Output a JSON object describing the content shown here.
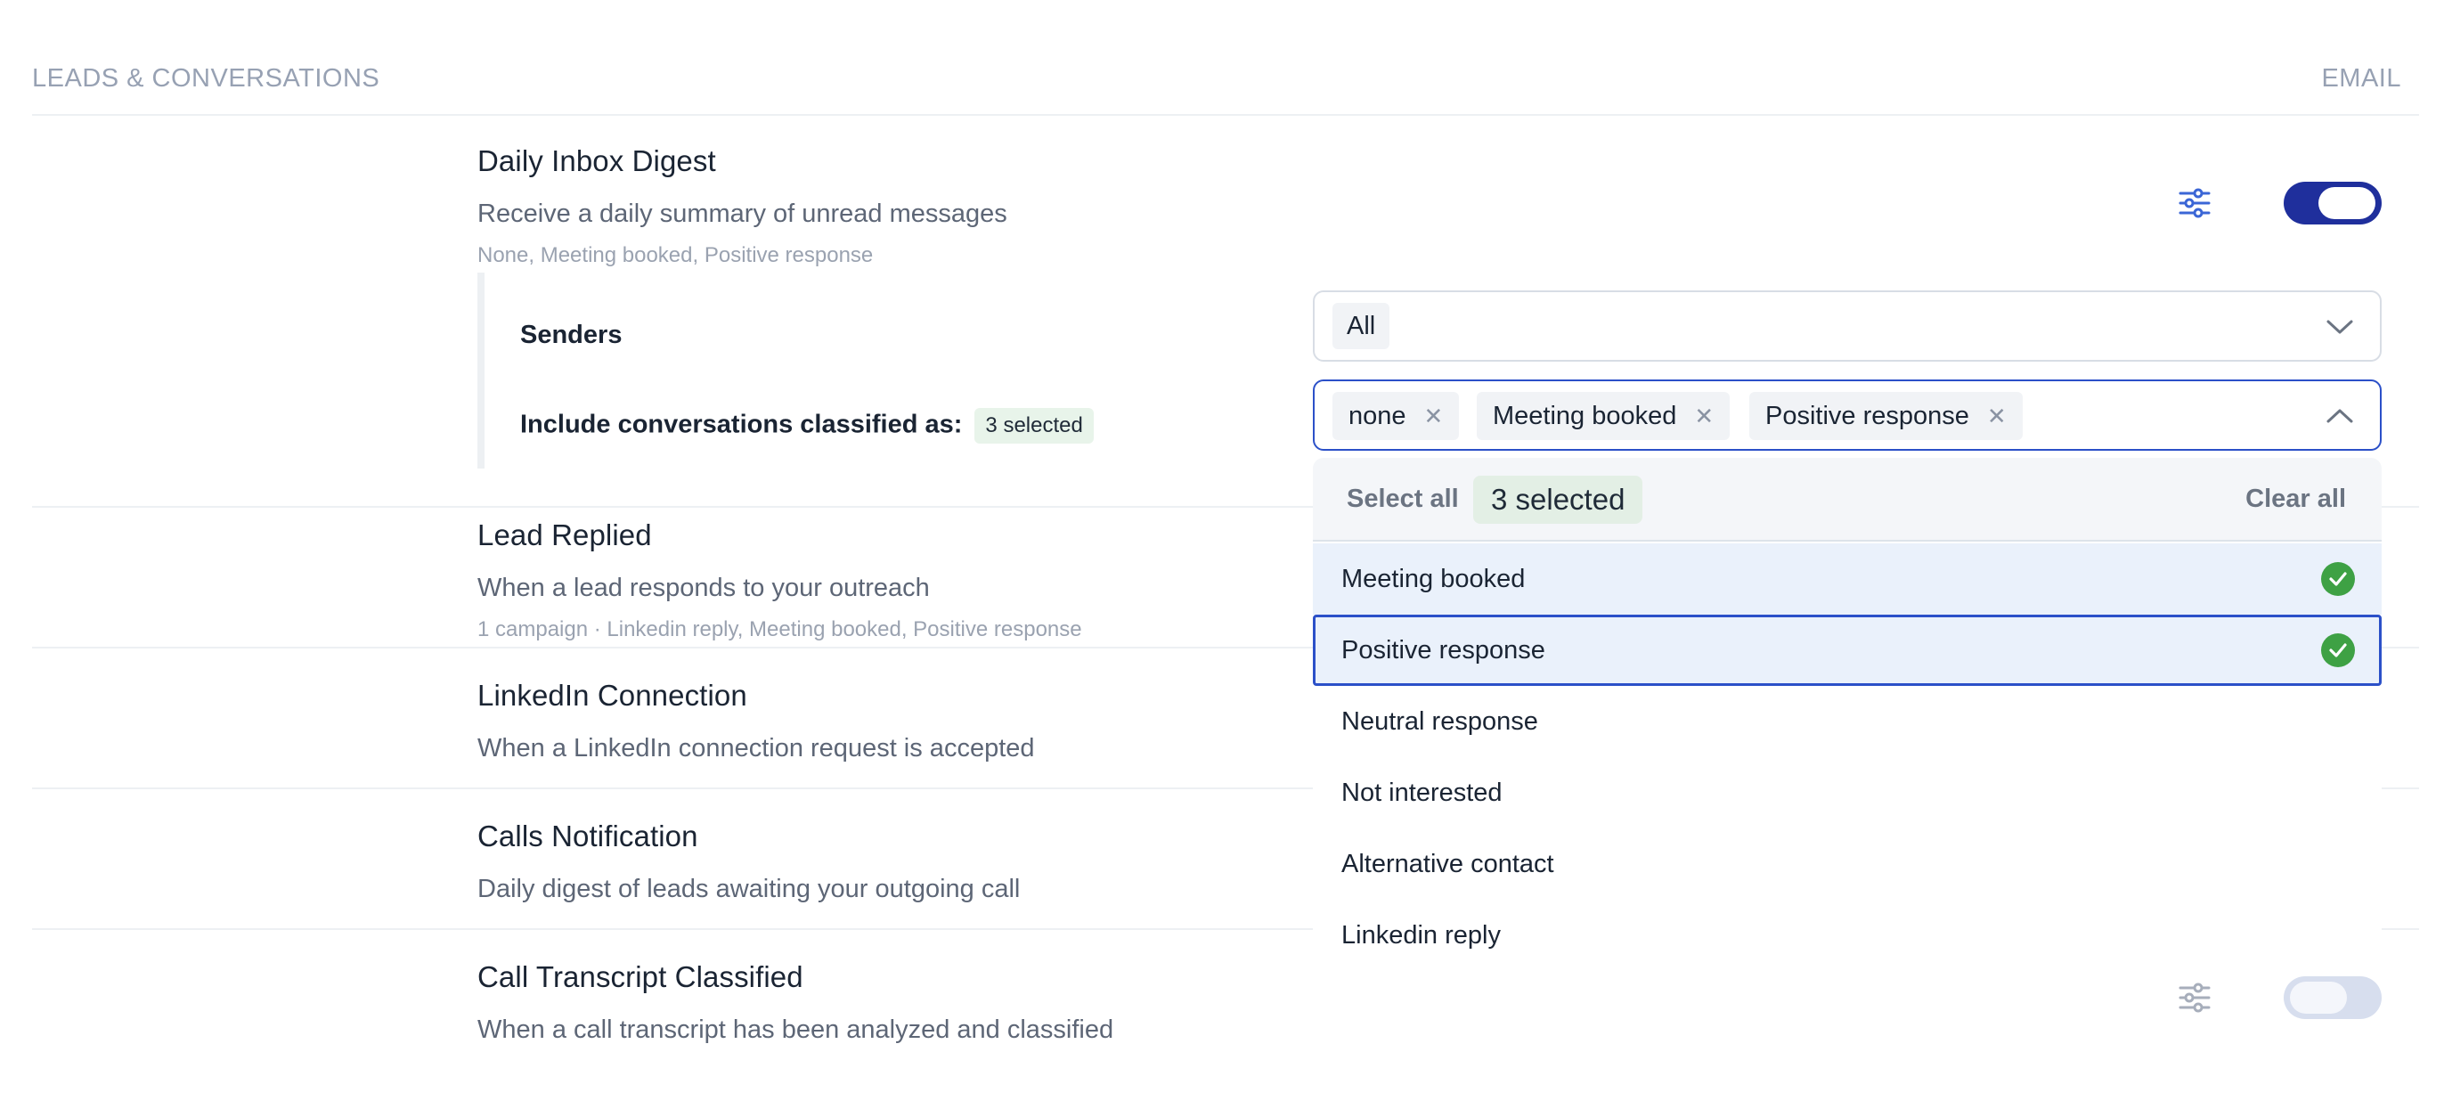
{
  "section": {
    "title": "LEADS & CONVERSATIONS",
    "channel": "EMAIL"
  },
  "rows": [
    {
      "title": "Daily Inbox Digest",
      "description": "Receive a daily summary of unread messages",
      "meta": "None, Meeting booked, Positive response"
    },
    {
      "title": "Lead Replied",
      "description": "When a lead responds to your outreach",
      "meta": "1 campaign · Linkedin reply, Meeting booked, Positive response"
    },
    {
      "title": "LinkedIn Connection",
      "description": "When a LinkedIn connection request is accepted"
    },
    {
      "title": "Calls Notification",
      "description": "Daily digest of leads awaiting your outgoing call"
    },
    {
      "title": "Call Transcript Classified",
      "description": "When a call transcript has been analyzed and classified"
    }
  ],
  "settings": {
    "senders_label": "Senders",
    "senders_value": "All",
    "classified_label": "Include conversations classified as:",
    "classified_badge": "3 selected",
    "tags": [
      "none",
      "Meeting booked",
      "Positive response"
    ]
  },
  "dropdown": {
    "select_all": "Select all",
    "badge": "3 selected",
    "clear_all": "Clear all",
    "options": [
      {
        "label": "Meeting booked",
        "selected": true
      },
      {
        "label": "Positive response",
        "selected": true
      },
      {
        "label": "Neutral response",
        "selected": false
      },
      {
        "label": "Not interested",
        "selected": false
      },
      {
        "label": "Alternative contact",
        "selected": false
      },
      {
        "label": "Linkedin reply",
        "selected": false
      }
    ]
  },
  "colors": {
    "toggle_on": "#1f2f9c",
    "toggle_off": "#d7deee",
    "accent": "#2b50c8",
    "check": "#3ea144"
  },
  "icons": {
    "settings": "sliders-icon",
    "chevron_closed": "chevron-down-icon",
    "chevron_open": "chevron-up-icon",
    "remove": "close-icon",
    "check": "check-circle-icon"
  }
}
